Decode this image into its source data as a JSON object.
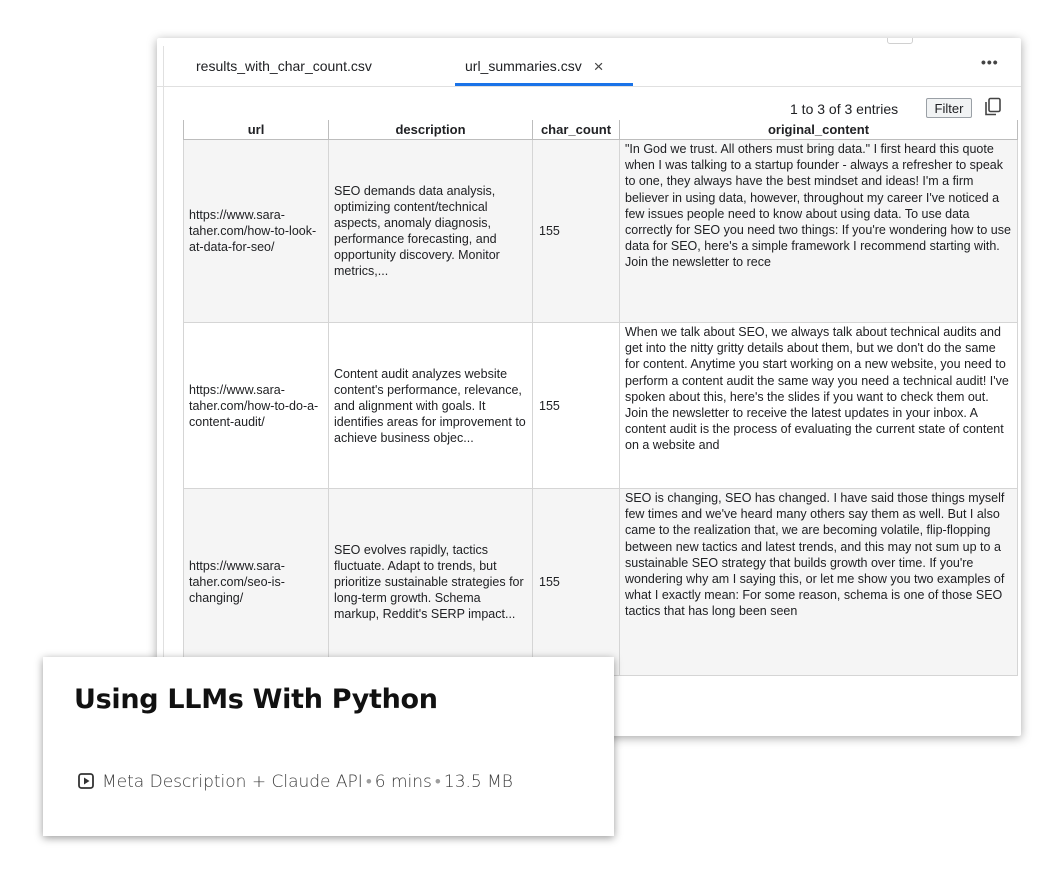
{
  "tabs": [
    {
      "label": "results_with_char_count.csv",
      "active": false
    },
    {
      "label": "url_summaries.csv",
      "active": true
    }
  ],
  "close_icon": "close-icon",
  "more_icon": "more-horizontal-icon",
  "more_label": "•••",
  "entries_text": "1 to 3 of 3 entries",
  "filter_label": "Filter",
  "copy_icon": "copy-icon",
  "accent_color": "#1a73e8",
  "table": {
    "columns": [
      "url",
      "description",
      "char_count",
      "original_content"
    ],
    "rows": [
      {
        "url": "https://www.sara-taher.com/how-to-look-at-data-for-seo/",
        "description": "SEO demands data analysis, optimizing content/technical aspects, anomaly diagnosis, performance forecasting, and opportunity discovery. Monitor metrics,...",
        "char_count": "155",
        "original_content": "\"In God we trust. All others must bring data.\" I first heard this quote when I was talking to a startup founder - always a refresher to speak to one, they always have the best mindset and ideas! I'm a firm believer in using data, however, throughout my career I've noticed a few issues people need to know about using data. To use data correctly for SEO you need two things: If you're wondering how to use data for SEO, here's a simple framework I recommend starting with. Join the newsletter to rece"
      },
      {
        "url": "https://www.sara-taher.com/how-to-do-a-content-audit/",
        "description": "Content audit analyzes website content's performance, relevance, and alignment with goals. It identifies areas for improvement to achieve business objec...",
        "char_count": "155",
        "original_content": "When we talk about SEO, we always talk about technical audits and get into the nitty gritty details about them, but we don't do the same for content. Anytime you start working on a new website, you need to perform a content audit the same way you need a technical audit! I've spoken about this, here's the slides if you want to check them out. Join the newsletter to receive the latest updates in your inbox. A content audit is the process of evaluating the current state of content on a website and"
      },
      {
        "url": "https://www.sara-taher.com/seo-is-changing/",
        "description": "SEO evolves rapidly, tactics fluctuate. Adapt to trends, but prioritize sustainable strategies for long-term growth. Schema markup, Reddit's SERP impact...",
        "char_count": "155",
        "original_content": "SEO is changing, SEO has changed. I have said those things myself few times and we've heard many others say them as well. But I also came to the realization that, we are becoming volatile, flip-flopping between new tactics and latest trends, and this may not sum up to a sustainable SEO strategy that builds growth over time. If you're wondering why am I saying this, or let me show you two examples of what I exactly mean: For some reason, schema is one of those SEO tactics that has long been seen"
      }
    ]
  },
  "card": {
    "title": "Using LLMs With Python",
    "icon": "play-box-icon",
    "topic": "Meta Description + Claude API",
    "separator": "•",
    "duration": "6 mins",
    "size": "13.5 MB"
  }
}
